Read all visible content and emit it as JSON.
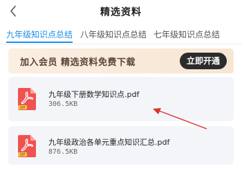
{
  "header": {
    "title": "精选资料",
    "back_icon": "chevron-left-icon"
  },
  "tabs": [
    {
      "label": "九年级知识点总结",
      "active": true
    },
    {
      "label": "八年级知识点总结",
      "active": false
    },
    {
      "label": "七年级知识点总结",
      "active": false
    }
  ],
  "banner": {
    "text": "加入会员 精选资料免费下载",
    "button_label": "立即开通"
  },
  "files": [
    {
      "name": "九年级下册数学知识点.pdf",
      "size": "306.5KB",
      "icon": "pdf-file-icon",
      "badge": "VIP"
    },
    {
      "name": "九年级政治各单元重点知识汇总.pdf",
      "size": "876.5KB",
      "icon": "pdf-file-icon",
      "badge": "VIP"
    }
  ],
  "colors": {
    "accent": "#1e8fe6",
    "pdf_red": "#ef5350",
    "annotation_arrow": "#d9342b",
    "banner_bg": "#fbeee2",
    "button_bg": "#2c2c2c"
  }
}
